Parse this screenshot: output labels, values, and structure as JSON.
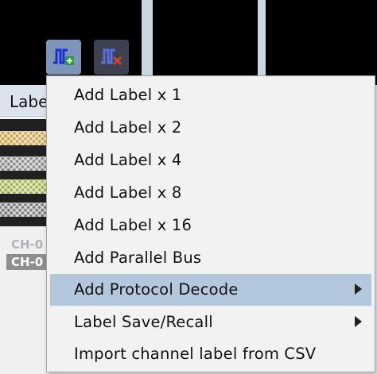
{
  "toolbar": {
    "add_label_icon": "pulse-add-icon",
    "delete_label_icon": "pulse-delete-icon"
  },
  "left_panel": {
    "tab_label": "Label",
    "channels": [
      "CH-0",
      "CH-0"
    ]
  },
  "context_menu": {
    "items": [
      {
        "label": "Add Label x 1",
        "has_submenu": false
      },
      {
        "label": "Add Label x 2",
        "has_submenu": false
      },
      {
        "label": "Add Label x 4",
        "has_submenu": false
      },
      {
        "label": "Add Label x 8",
        "has_submenu": false
      },
      {
        "label": "Add Label x 16",
        "has_submenu": false
      },
      {
        "label": "Add Parallel Bus",
        "has_submenu": false
      },
      {
        "label": "Add Protocol Decode",
        "has_submenu": true,
        "highlighted": true
      },
      {
        "label": "Label Save/Recall",
        "has_submenu": true
      },
      {
        "label": "Import channel label from CSV",
        "has_submenu": false
      }
    ]
  },
  "colors": {
    "menu_background": "#f2f2f2",
    "menu_highlight": "#b3c7dd",
    "app_background": "#000000"
  }
}
